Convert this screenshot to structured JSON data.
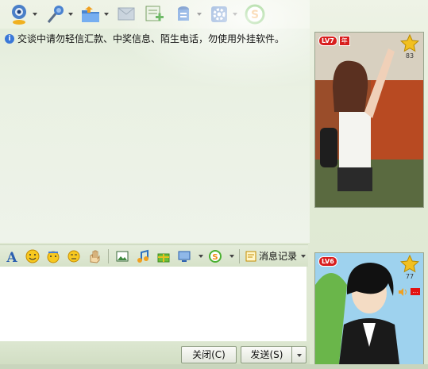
{
  "toolbar": {
    "items": [
      {
        "icon": "webcam-icon"
      },
      {
        "icon": "microphone-icon"
      },
      {
        "icon": "folder-icon"
      },
      {
        "icon": "message-icon"
      },
      {
        "icon": "add-contact-icon"
      },
      {
        "icon": "contact-card-icon"
      },
      {
        "icon": "settings-icon"
      },
      {
        "icon": "soso-icon"
      }
    ]
  },
  "notice": {
    "text": "交谈中请勿轻信汇款、中奖信息、陌生电话，勿使用外挂软件。"
  },
  "profile_top": {
    "level": "LV7",
    "year_badge": "年",
    "star_count": "83"
  },
  "profile_bottom": {
    "level": "LV6",
    "star_count": "77"
  },
  "format_toolbar": {
    "history_label": "消息记录"
  },
  "buttons": {
    "close": "关闭(C)",
    "send": "发送(S)"
  },
  "colors": {
    "accent_red": "#d81e1e",
    "panel_green": "#dfe9d3"
  }
}
